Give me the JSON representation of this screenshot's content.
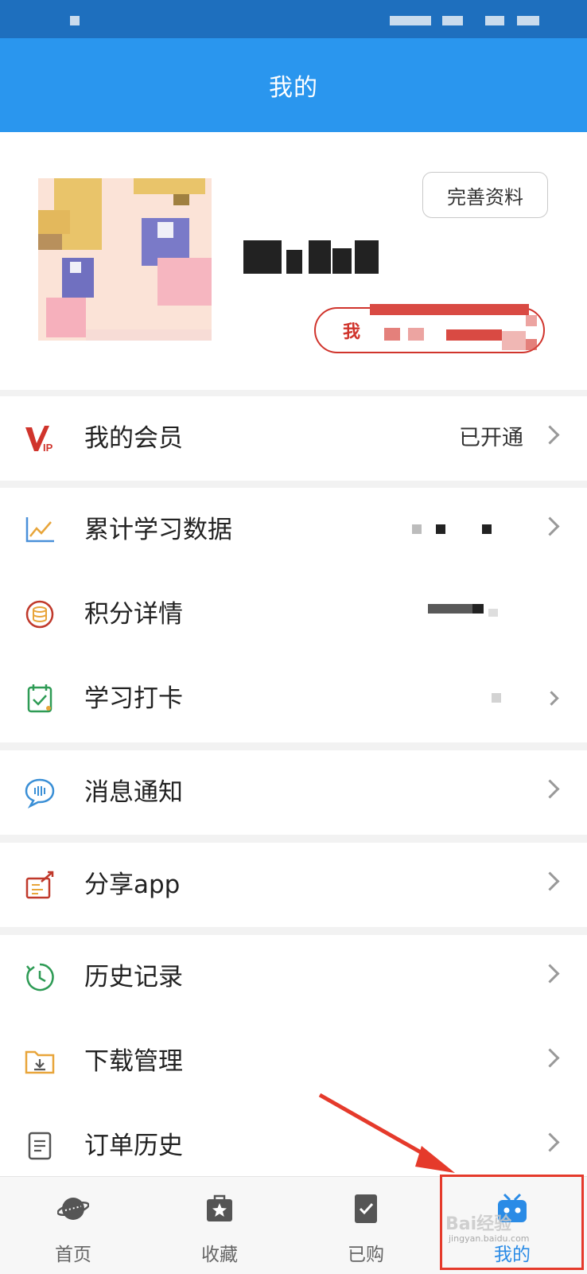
{
  "header": {
    "title": "我的"
  },
  "profile": {
    "edit_label": "完善资料",
    "member_badge_label": "我"
  },
  "menu": {
    "vip": {
      "label": "我的会员",
      "value": "已开通"
    },
    "study_data": {
      "label": "累计学习数据"
    },
    "points": {
      "label": "积分详情"
    },
    "checkin": {
      "label": "学习打卡"
    },
    "messages": {
      "label": "消息通知"
    },
    "share": {
      "label": "分享app"
    },
    "history": {
      "label": "历史记录"
    },
    "downloads": {
      "label": "下载管理"
    },
    "orders": {
      "label": "订单历史"
    }
  },
  "tabs": [
    {
      "label": "首页",
      "icon": "planet-icon"
    },
    {
      "label": "收藏",
      "icon": "star-bag-icon"
    },
    {
      "label": "已购",
      "icon": "purchased-icon"
    },
    {
      "label": "我的",
      "icon": "profile-tv-icon",
      "active": true
    }
  ],
  "watermark": {
    "brand": "Bai经验",
    "url": "jingyan.baidu.com"
  },
  "colors": {
    "primary": "#2a96ee",
    "accent_red": "#d0342c",
    "highlight": "#e53a2b"
  }
}
